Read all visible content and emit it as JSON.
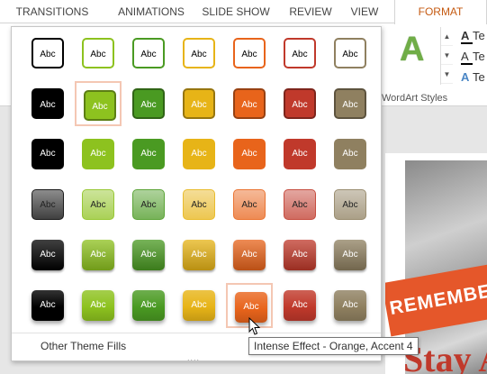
{
  "ribbon_tabs": [
    {
      "label": "TRANSITIONS",
      "active": false
    },
    {
      "label": "ANIMATIONS",
      "active": false
    },
    {
      "label": "SLIDE SHOW",
      "active": false
    },
    {
      "label": "REVIEW",
      "active": false
    },
    {
      "label": "VIEW",
      "active": false
    },
    {
      "label": "FORMAT",
      "active": true
    }
  ],
  "wordart": {
    "sample_letter": "A",
    "group_label": "WordArt Styles",
    "options": [
      {
        "glyph": "A",
        "label": "Te"
      },
      {
        "glyph": "A",
        "label": "Te"
      },
      {
        "glyph": "A",
        "label": "Te"
      }
    ]
  },
  "slide": {
    "banner_text": "REMEMBER",
    "headline_text": "Stay Ac"
  },
  "gallery": {
    "swatch_label": "Abc",
    "more_link": "Other Theme Fills",
    "resize_grip": "....",
    "colors": [
      "#000000",
      "#8dc21f",
      "#4a9a22",
      "#e7b417",
      "#e8641b",
      "#c0392b",
      "#8f8060"
    ],
    "rows": [
      {
        "style": "outline"
      },
      {
        "style": "solid-border"
      },
      {
        "style": "solid"
      },
      {
        "style": "gradient-light"
      },
      {
        "style": "gradient-dark"
      },
      {
        "style": "intense"
      }
    ],
    "highlighted": [
      {
        "row": 1,
        "col": 1
      },
      {
        "row": 5,
        "col": 4
      }
    ]
  },
  "tooltip": {
    "text": "Intense Effect - Orange, Accent 4"
  }
}
